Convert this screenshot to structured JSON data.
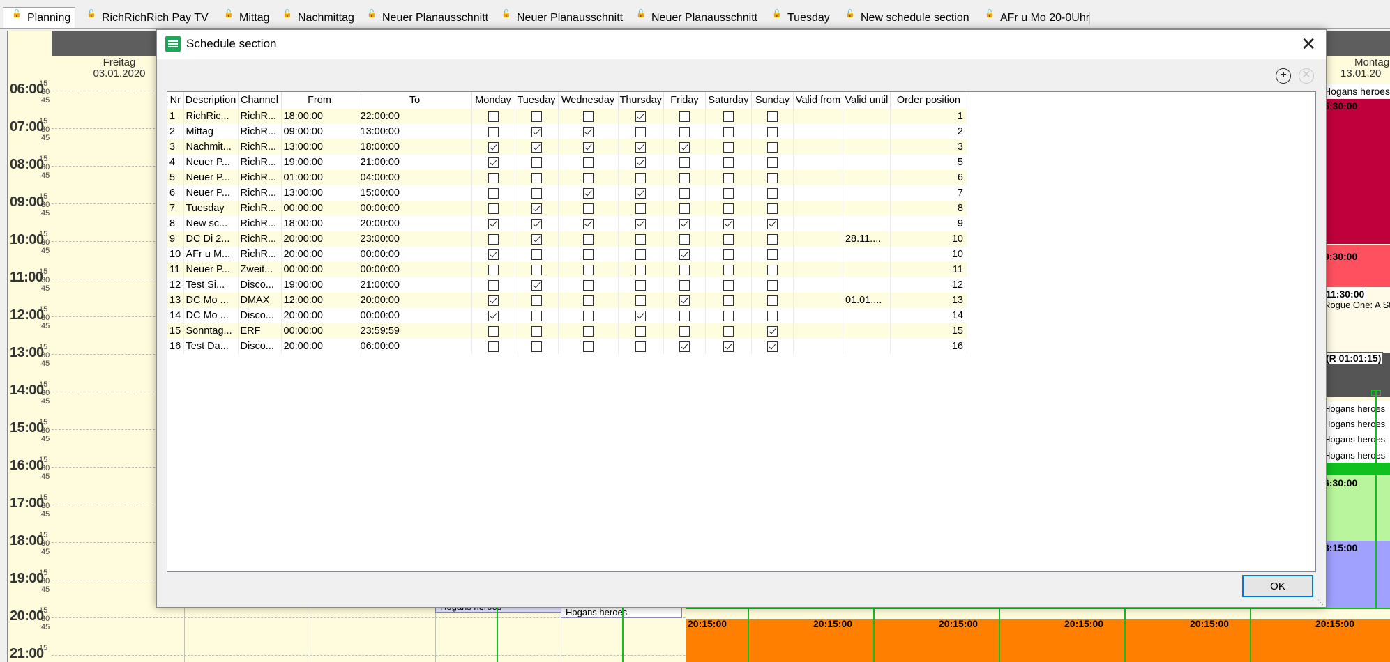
{
  "tabs": [
    {
      "label": "Planning",
      "active": true
    },
    {
      "label": "RichRichRich Pay TV"
    },
    {
      "label": "Mittag"
    },
    {
      "label": "Nachmittag"
    },
    {
      "label": "Neuer Planausschnitt"
    },
    {
      "label": "Neuer Planausschnitt"
    },
    {
      "label": "Neuer Planausschnitt"
    },
    {
      "label": "Tuesday"
    },
    {
      "label": "New schedule section"
    },
    {
      "label": "AFr u Mo 20-0Uhr"
    }
  ],
  "planner": {
    "day_left": {
      "name": "Freitag",
      "date": "03.01.2020"
    },
    "day_right": {
      "name": "Montag",
      "date": "13.01.20"
    },
    "hours": [
      "06:00",
      "07:00",
      "08:00",
      "09:00",
      "10:00",
      "11:00",
      "12:00",
      "13:00",
      "14:00",
      "15:00",
      "16:00",
      "17:00",
      "18:00",
      "19:00",
      "20:00",
      "21:00"
    ],
    "minute_marks": [
      "15",
      ":30",
      ":45"
    ],
    "right_labels": {
      "hogans": "Hogans heroes",
      "t1": "5:30:00",
      "t2": "0:30:00",
      "t3": "11:30:00",
      "rogue": "Rogue One: A Sta",
      "t4": "(R 01:01:15) ",
      "t5": "6:30:00",
      "t6": "8:15:00"
    },
    "bottom_events": {
      "hogans_a": "Hogans heroes",
      "hogans_b": "Hogans heroes"
    },
    "bottom_times": [
      "20:15:00",
      "20:15:00",
      "20:15:00",
      "20:15:00",
      "20:15:00",
      "20:15:00"
    ]
  },
  "dialog": {
    "title": "Schedule section",
    "close_icon": "close-icon",
    "add_icon": "plus-circle-icon",
    "remove_icon": "x-circle-icon",
    "ok_label": "OK",
    "columns": [
      "Nr",
      "Description",
      "Channel",
      "From",
      "To",
      "Monday",
      "Tuesday",
      "Wednesday",
      "Thursday",
      "Friday",
      "Saturday",
      "Sunday",
      "Valid from",
      "Valid until",
      "Order position"
    ],
    "rows": [
      {
        "nr": "1",
        "desc": "RichRic...",
        "channel": "RichR...",
        "from": "18:00:00",
        "to": "22:00:00",
        "days": [
          false,
          false,
          false,
          true,
          false,
          false,
          false
        ],
        "valid_from": "",
        "valid_until": "",
        "order": "1"
      },
      {
        "nr": "2",
        "desc": "Mittag",
        "channel": "RichR...",
        "from": "09:00:00",
        "to": "13:00:00",
        "days": [
          false,
          true,
          true,
          false,
          false,
          false,
          false
        ],
        "valid_from": "",
        "valid_until": "",
        "order": "2"
      },
      {
        "nr": "3",
        "desc": "Nachmit...",
        "channel": "RichR...",
        "from": "13:00:00",
        "to": "18:00:00",
        "days": [
          true,
          true,
          true,
          true,
          true,
          false,
          false
        ],
        "valid_from": "",
        "valid_until": "",
        "order": "3"
      },
      {
        "nr": "4",
        "desc": "Neuer P...",
        "channel": "RichR...",
        "from": "19:00:00",
        "to": "21:00:00",
        "days": [
          true,
          false,
          false,
          true,
          false,
          false,
          false
        ],
        "valid_from": "",
        "valid_until": "",
        "order": "5"
      },
      {
        "nr": "5",
        "desc": "Neuer P...",
        "channel": "RichR...",
        "from": "01:00:00",
        "to": "04:00:00",
        "days": [
          false,
          false,
          false,
          false,
          false,
          false,
          false
        ],
        "valid_from": "",
        "valid_until": "",
        "order": "6"
      },
      {
        "nr": "6",
        "desc": "Neuer P...",
        "channel": "RichR...",
        "from": "13:00:00",
        "to": "15:00:00",
        "days": [
          false,
          false,
          true,
          true,
          false,
          false,
          false
        ],
        "valid_from": "",
        "valid_until": "",
        "order": "7"
      },
      {
        "nr": "7",
        "desc": "Tuesday",
        "channel": "RichR...",
        "from": "00:00:00",
        "to": "00:00:00",
        "days": [
          false,
          true,
          false,
          false,
          false,
          false,
          false
        ],
        "valid_from": "",
        "valid_until": "",
        "order": "8"
      },
      {
        "nr": "8",
        "desc": "New sc...",
        "channel": "RichR...",
        "from": "18:00:00",
        "to": "20:00:00",
        "days": [
          true,
          true,
          true,
          true,
          true,
          true,
          true
        ],
        "valid_from": "",
        "valid_until": "",
        "order": "9"
      },
      {
        "nr": "9",
        "desc": "DC Di 2...",
        "channel": "RichR...",
        "from": "20:00:00",
        "to": "23:00:00",
        "days": [
          false,
          true,
          false,
          false,
          false,
          false,
          false
        ],
        "valid_from": "",
        "valid_until": "28.11....",
        "order": "10"
      },
      {
        "nr": "10",
        "desc": "AFr u M...",
        "channel": "RichR...",
        "from": "20:00:00",
        "to": "00:00:00",
        "days": [
          true,
          false,
          false,
          false,
          true,
          false,
          false
        ],
        "valid_from": "",
        "valid_until": "",
        "order": "10"
      },
      {
        "nr": "11",
        "desc": "Neuer P...",
        "channel": "Zweit...",
        "from": "00:00:00",
        "to": "00:00:00",
        "days": [
          false,
          false,
          false,
          false,
          false,
          false,
          false
        ],
        "valid_from": "",
        "valid_until": "",
        "order": "11"
      },
      {
        "nr": "12",
        "desc": "Test Si...",
        "channel": "Disco...",
        "from": "19:00:00",
        "to": "21:00:00",
        "days": [
          false,
          true,
          false,
          false,
          false,
          false,
          false
        ],
        "valid_from": "",
        "valid_until": "",
        "order": "12"
      },
      {
        "nr": "13",
        "desc": "DC Mo ...",
        "channel": "DMAX",
        "from": "12:00:00",
        "to": "20:00:00",
        "days": [
          true,
          false,
          false,
          false,
          true,
          false,
          false
        ],
        "valid_from": "",
        "valid_until": "01.01....",
        "order": "13"
      },
      {
        "nr": "14",
        "desc": "DC Mo ...",
        "channel": "Disco...",
        "from": "20:00:00",
        "to": "00:00:00",
        "days": [
          true,
          false,
          false,
          true,
          false,
          false,
          false
        ],
        "valid_from": "",
        "valid_until": "",
        "order": "14"
      },
      {
        "nr": "15",
        "desc": "Sonntag...",
        "channel": "ERF",
        "from": "00:00:00",
        "to": "23:59:59",
        "days": [
          false,
          false,
          false,
          false,
          false,
          false,
          true
        ],
        "valid_from": "",
        "valid_until": "",
        "order": "15"
      },
      {
        "nr": "16",
        "desc": "Test Da...",
        "channel": "Disco...",
        "from": "20:00:00",
        "to": "06:00:00",
        "days": [
          false,
          false,
          false,
          false,
          true,
          true,
          true
        ],
        "valid_from": "",
        "valid_until": "",
        "order": "16"
      }
    ]
  }
}
